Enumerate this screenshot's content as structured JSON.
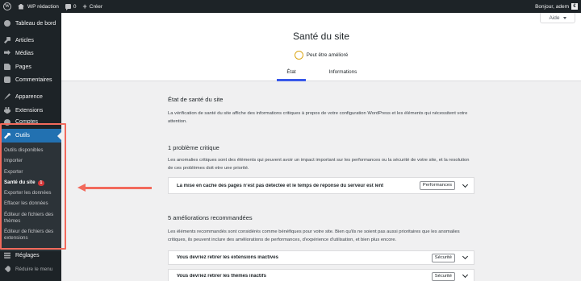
{
  "adminbar": {
    "site_name": "WP rédaction",
    "comments_count": "0",
    "new_label": "Créer",
    "greeting": "Bonjour, adem"
  },
  "sidebar": {
    "items": [
      {
        "label": "Tableau de bord",
        "icon": "dashboard-icon"
      },
      {
        "label": "Articles",
        "icon": "pin-icon"
      },
      {
        "label": "Médias",
        "icon": "media-icon"
      },
      {
        "label": "Pages",
        "icon": "page-icon"
      },
      {
        "label": "Commentaires",
        "icon": "comment-icon"
      },
      {
        "label": "Apparence",
        "icon": "brush-icon"
      },
      {
        "label": "Extensions",
        "icon": "plugin-icon"
      },
      {
        "label": "Comptes",
        "icon": "users-icon"
      },
      {
        "label": "Outils",
        "icon": "wrench-icon"
      },
      {
        "label": "Réglages",
        "icon": "settings-icon"
      },
      {
        "label": "Réduire le menu",
        "icon": "collapse-icon"
      }
    ],
    "submenu": [
      "Outils disponibles",
      "Importer",
      "Exporter",
      "Santé du site",
      "Exporter les données",
      "Effacer les données",
      "Éditeur de fichiers des thèmes",
      "Éditeur de fichiers des extensions"
    ],
    "site_health_badge": "1"
  },
  "help": {
    "label": "Aide"
  },
  "header": {
    "title": "Santé du site",
    "status": "Peut être amélioré",
    "tabs": [
      "État",
      "Informations"
    ],
    "status_color": "#dba617",
    "tab_accent": "#3858e9"
  },
  "content": {
    "section_title": "État de santé du site",
    "section_text": "La vérification de santé du site affiche des informations critiques à propos de votre configuration WordPress et les éléments qui nécessitent votre attention.",
    "critical_title": "1 problème critique",
    "critical_text": "Les anomalies critiques sont des éléments qui peuvent avoir un impact important sur les performances ou la sécurité de votre site, et la resolution de ces problèmes doit etre une priorité.",
    "critical_issues": [
      {
        "label": "La mise en cache des pages n’est pas détectée et le temps de réponse du serveur est lent",
        "badge": "Performances"
      }
    ],
    "recommended_title": "5 améliorations recommandées",
    "recommended_text": "Les éléments recommandés sont considérés comme bénéfiques pour votre site. Bien qu'ils ne soient pas aussi prioritaires que les anomalies critiques, ils peuvent inclure des améliorations de performances, d'expérience d'utilisation, et bien plus encore.",
    "recommended_issues": [
      {
        "label": "Vous devriez retirer les extensions inactives",
        "badge": "Sécurité"
      },
      {
        "label": "Vous devriez retirer les thèmes inactifs",
        "badge": "Sécurité"
      }
    ]
  },
  "colors": {
    "admin_dark": "#1d2327",
    "active_blue": "#2271b1",
    "annotation": "#f26a5c"
  }
}
